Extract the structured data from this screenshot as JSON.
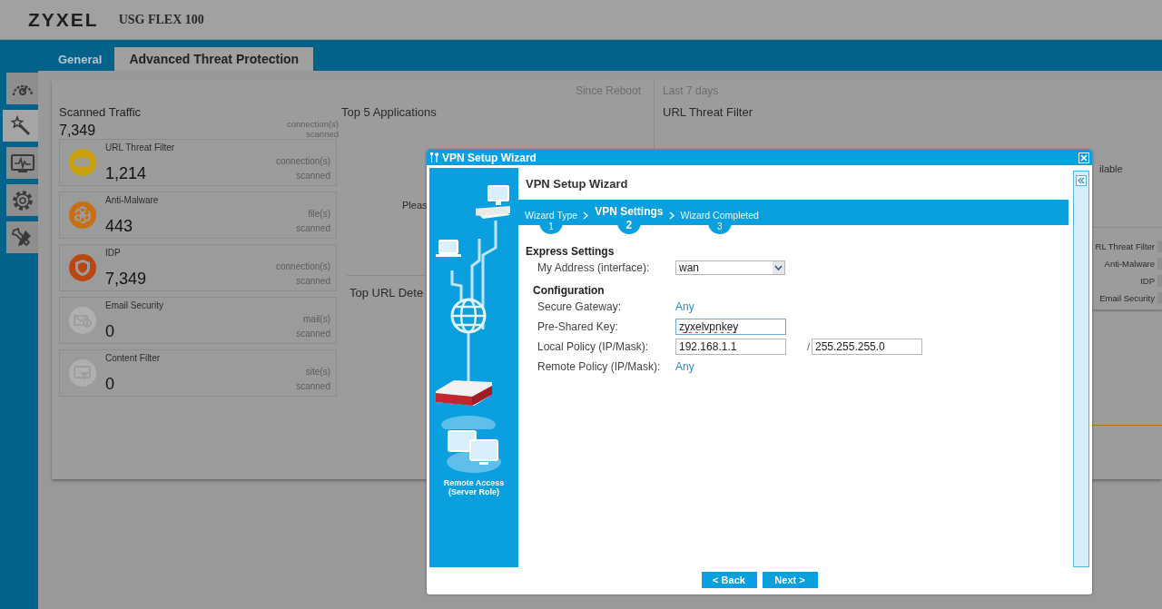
{
  "header": {
    "logo": "ZYXEL",
    "model": "USG FLEX 100"
  },
  "tabs": [
    {
      "label": "General",
      "selected": false
    },
    {
      "label": "Advanced Threat Protection",
      "selected": true
    }
  ],
  "sidebar": {
    "items": [
      {
        "kind": "gauge",
        "selected": false
      },
      {
        "kind": "wand",
        "selected": true
      },
      {
        "kind": "monitor",
        "selected": false
      },
      {
        "kind": "gear",
        "selected": false
      },
      {
        "kind": "tools",
        "selected": false
      }
    ]
  },
  "dashboard": {
    "periods": [
      "Since Reboot",
      "Last 7 days"
    ],
    "scanned_traffic": {
      "title": "Scanned Traffic",
      "count": "7,349",
      "unit": "connection(s)",
      "unit_note": "scanned"
    },
    "stats": [
      {
        "kind": "robot",
        "name": "URL Threat Filter",
        "count": "1,214",
        "unit": "connection(s)",
        "unit_note": "scanned",
        "active": true,
        "color": "#c9a10f"
      },
      {
        "kind": "biohazard",
        "name": "Anti-Malware",
        "count": "443",
        "unit": "file(s)",
        "unit_note": "scanned",
        "active": true,
        "color": "#c8700f"
      },
      {
        "kind": "shield",
        "name": "IDP",
        "count": "7,349",
        "unit": "connection(s)",
        "unit_note": "scanned",
        "active": true,
        "color": "#b8480f"
      },
      {
        "kind": "mail",
        "name": "Email Security",
        "count": "0",
        "unit": "mail(s)",
        "unit_note": "scanned",
        "active": false
      },
      {
        "kind": "filter",
        "name": "Content Filter",
        "count": "0",
        "unit": "site(s)",
        "unit_note": "scanned",
        "active": false
      }
    ],
    "top_applications": {
      "title": "Top 5 Applications",
      "message": "Pleas"
    },
    "top_url": {
      "title": "Top URL Dete"
    },
    "url_threat_filter": {
      "title": "URL Threat Filter",
      "message": "ilable",
      "legend": [
        "RL Threat Filter",
        "Anti-Malware",
        "IDP",
        "Email Security"
      ]
    }
  },
  "dialog": {
    "title": "VPN Setup Wizard",
    "heading": "VPN Setup Wizard",
    "steps": [
      {
        "label": "Wizard Type",
        "number": "1",
        "selected": false
      },
      {
        "label": "VPN Settings",
        "number": "2",
        "selected": true
      },
      {
        "label": "Wizard Completed",
        "number": "3",
        "selected": false
      }
    ],
    "role_label": "Remote Access (Server Role)",
    "sections": [
      {
        "title": "Express Settings",
        "fields": [
          {
            "kind": "select",
            "label": "My Address (interface):",
            "value": "wan"
          }
        ]
      },
      {
        "title": "Configuration",
        "fields": [
          {
            "kind": "link",
            "label": "Secure Gateway:",
            "value": "Any"
          },
          {
            "kind": "text",
            "label": "Pre-Shared Key:",
            "value": "zyxelvpnkey",
            "focused": true
          },
          {
            "kind": "ip_mask",
            "label": "Local Policy (IP/Mask):",
            "value": "192.168.1.1",
            "separator": "/",
            "mask": "255.255.255.0",
            "focused": false
          },
          {
            "kind": "link",
            "label": "Remote Policy (IP/Mask):",
            "value": "Any"
          }
        ]
      }
    ],
    "buttons": [
      "< Back",
      "Next >"
    ]
  }
}
